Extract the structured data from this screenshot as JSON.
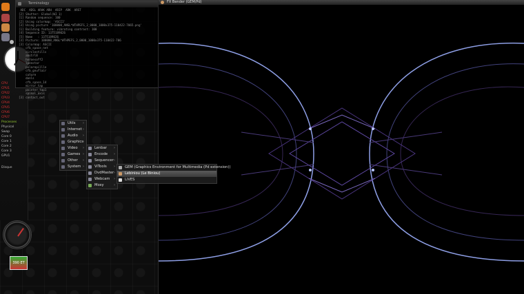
{
  "terminal": {
    "title": "Terminology",
    "lines": [
      " ADC  ADSL ARAK ARH  ARIP  ARK  ARST",
      "[2] Shutter: Global(WI 1)",
      "[1] Random sequence: 100",
      "[2] Using colormap: 'ASCII'",
      "[3] Using picture '100000_ANGL*WTHPEFS_2_0000_1000x375-110422-7065.png'",
      "[1] Building feature: vibrating contrast: 100",
      "[4] Sequence ID: 1375189026",
      "[5] Name   : 1375189026",
      "[3] Picture: 100000_ANGL*WTHPEFS_2_0000_1000x375-110422-706",
      "[3] Colormap: ASCII",
      "    cfb_space_net",
      "    circlestills",
      "    abstrl8",
      "    heroesoff2",
      "    lpenstar",
      "    polarepillle",
      "    cfb_gnuflair",
      "    cuture",
      "    donls",
      "    cfb_space_14",
      "    mirror_tap",
      "    pointer_tap1",
      "    spinal_axis",
      "[3] contact_out"
    ]
  },
  "app": {
    "title": "FX Bender (GEM/Pd)"
  },
  "menu_main": {
    "items": [
      "Utils",
      "Internet",
      "Audio",
      "Graphics",
      "Video",
      "Games",
      "Other",
      "System"
    ]
  },
  "menu_video": {
    "items": [
      "Lenbar",
      "Encode",
      "Sequencer",
      "ViTools",
      "DvdMaster",
      "Webcam",
      "Moxy"
    ]
  },
  "menu_vitools": {
    "items": [
      "GEM (Graphics Environment for Multimedia (Pd extension))",
      "Lebiniou (Le Biniou)",
      "LiVES"
    ]
  },
  "system_monitor": {
    "cpus": [
      "CPU",
      "CPU1",
      "CPU2",
      "CPU3",
      "CPU4",
      "CPU5",
      "CPU6",
      "CPU7"
    ],
    "labels": [
      "Processes",
      "Physical",
      "Swap",
      "Core 0",
      "Core 1",
      "Core 2",
      "Core 3",
      "GPU1"
    ],
    "disk_label": "Disque"
  },
  "tray": {
    "label": "390 ET"
  },
  "colors": {
    "wave": "#8fa6ff",
    "wave_dim": "#5a3f8c",
    "menu_sel": "#4b4b4b"
  }
}
